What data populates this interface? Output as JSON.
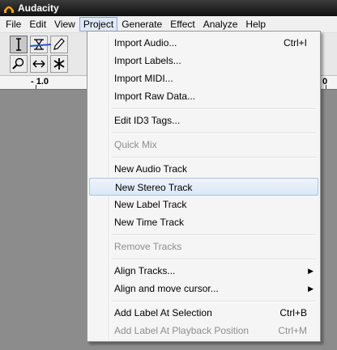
{
  "window": {
    "title": "Audacity"
  },
  "menubar": {
    "items": [
      "File",
      "Edit",
      "View",
      "Project",
      "Generate",
      "Effect",
      "Analyze",
      "Help"
    ]
  },
  "ruler": {
    "labels": [
      "- 1.0",
      "0"
    ]
  },
  "project_menu": {
    "import_audio": {
      "label": "Import Audio...",
      "shortcut": "Ctrl+I"
    },
    "import_labels": {
      "label": "Import Labels..."
    },
    "import_midi": {
      "label": "Import MIDI..."
    },
    "import_raw": {
      "label": "Import Raw Data..."
    },
    "edit_id3": {
      "label": "Edit ID3 Tags..."
    },
    "quick_mix": {
      "label": "Quick Mix"
    },
    "new_audio_track": {
      "label": "New Audio Track"
    },
    "new_stereo_track": {
      "label": "New Stereo Track"
    },
    "new_label_track": {
      "label": "New Label Track"
    },
    "new_time_track": {
      "label": "New Time Track"
    },
    "remove_tracks": {
      "label": "Remove Tracks"
    },
    "align_tracks": {
      "label": "Align Tracks...",
      "arrow": "▶"
    },
    "align_move_cursor": {
      "label": "Align and move cursor...",
      "arrow": "▶"
    },
    "add_label_selection": {
      "label": "Add Label At Selection",
      "shortcut": "Ctrl+B"
    },
    "add_label_playback": {
      "label": "Add Label At Playback Position",
      "shortcut": "Ctrl+M"
    }
  },
  "colors": {
    "menu_highlight": "#dbe8f7",
    "disabled_text": "#8d8d8d",
    "track_background": "#8c8c8c"
  }
}
